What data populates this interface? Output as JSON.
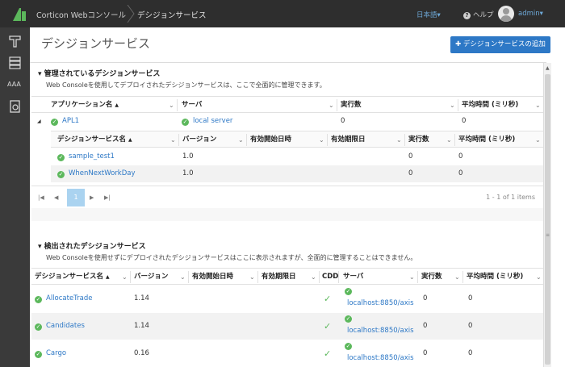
{
  "header": {
    "app_title": "Corticon Webコンソール",
    "page_crumb": "デシジョンサービス",
    "language": "日本語▾",
    "help": "ヘルプ",
    "user": "admin▾"
  },
  "sidebar": {
    "icons": [
      "decision-service-icon",
      "database-icon",
      "text-aa-icon",
      "clipboard-icon"
    ]
  },
  "page": {
    "title": "デシジョンサービス",
    "add_button": "デシジョンサービスの追加"
  },
  "managed": {
    "title": "管理されているデシジョンサービス",
    "description": "Web Consoleを使用してデプロイされたデシジョンサービスは、ここで全面的に管理できます。",
    "app_columns": [
      "アプリケーション名",
      "サーバ",
      "実行数",
      "平均時間 (ミリ秒)"
    ],
    "app_row": {
      "name": "APL1",
      "server": "local server",
      "executions": "0",
      "avg_time": "0"
    },
    "service_columns": [
      "デシジョンサービス名",
      "バージョン",
      "有効開始日時",
      "有効期限日",
      "実行数",
      "平均時間 (ミリ秒)"
    ],
    "services": [
      {
        "name": "sample_test1",
        "version": "1.0",
        "start": "",
        "end": "",
        "executions": "0",
        "avg_time": "0"
      },
      {
        "name": "WhenNextWorkDay",
        "version": "1.0",
        "start": "",
        "end": "",
        "executions": "0",
        "avg_time": "0"
      }
    ],
    "pager": {
      "current_page": "1",
      "info": "1 - 1 of 1 items"
    }
  },
  "detected": {
    "title": "検出されたデシジョンサービス",
    "description": "Web Consoleを使用せずにデプロイされたデシジョンサービスはここに表示されますが、全面的に管理することはできません。",
    "columns": [
      "デシジョンサービス名",
      "バージョン",
      "有効開始日時",
      "有効期限日",
      "CDD",
      "サーバ",
      "実行数",
      "平均時間 (ミリ秒)"
    ],
    "rows": [
      {
        "name": "AllocateTrade",
        "version": "1.14",
        "start": "",
        "end": "",
        "cdd": "✓",
        "server": "localhost:8850/axis",
        "executions": "0",
        "avg_time": "0"
      },
      {
        "name": "Candidates",
        "version": "1.14",
        "start": "",
        "end": "",
        "cdd": "✓",
        "server": "localhost:8850/axis",
        "executions": "0",
        "avg_time": "0"
      },
      {
        "name": "Cargo",
        "version": "0.16",
        "start": "",
        "end": "",
        "cdd": "✓",
        "server": "localhost:8850/axis",
        "executions": "0",
        "avg_time": "0"
      }
    ]
  },
  "colors": {
    "topbar": "#2e2e2e",
    "sidebar": "#3a3a3a",
    "accent": "#2d78c6",
    "success": "#5cb85c",
    "stripe": "#f2f2f2"
  }
}
